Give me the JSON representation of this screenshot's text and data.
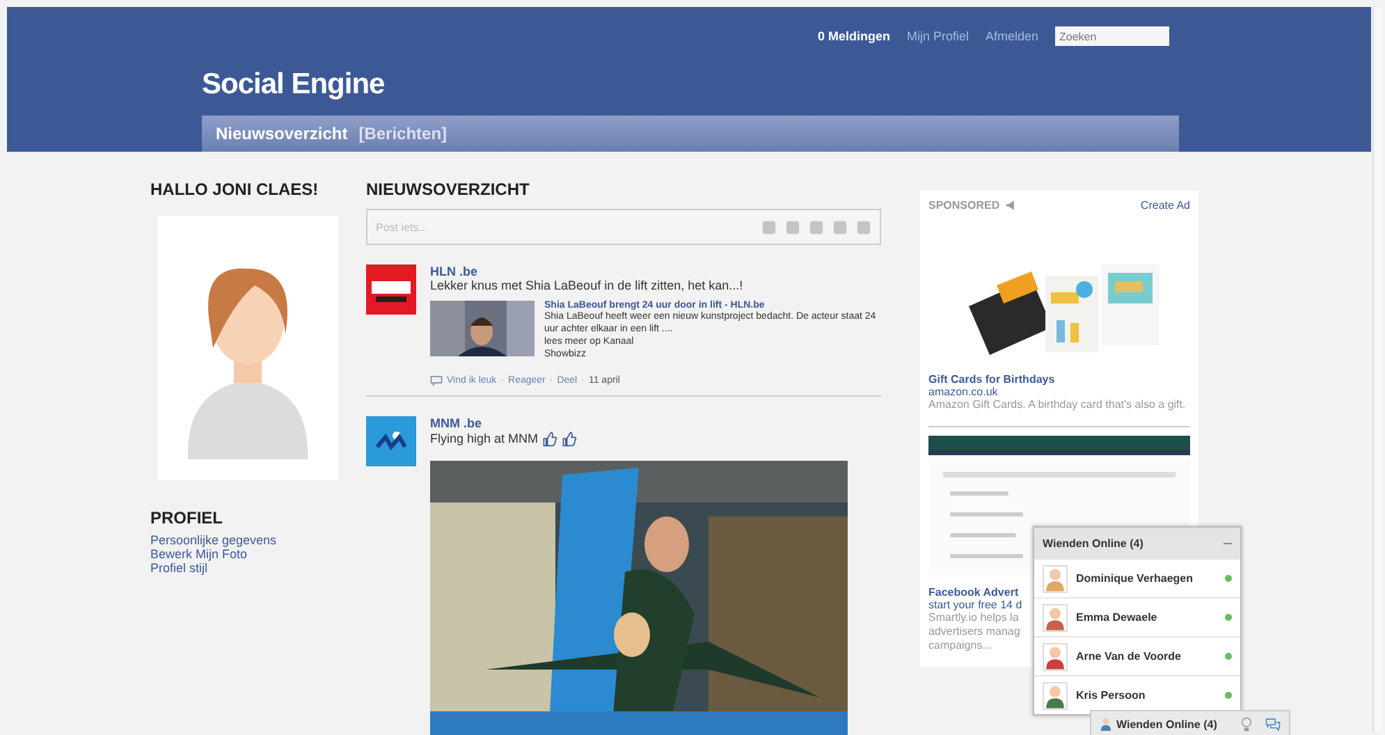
{
  "header": {
    "notifications": "0 Meldingen",
    "links": [
      "Mijn Profiel",
      "Afmelden"
    ],
    "search": {
      "placeholder": "Zoeken"
    },
    "title": "Social Engine"
  },
  "nav": {
    "items": [
      {
        "label": "Nieuwsoverzicht",
        "selected": true
      },
      {
        "label": "[Berichten]",
        "selected": false
      }
    ]
  },
  "left": {
    "greeting": "HALLO JONI CLAES!",
    "profile_heading": "PROFIEL",
    "profile_links": [
      "Persoonlijke gegevens",
      "Bewerk Mijn Foto",
      "Profiel stijl"
    ]
  },
  "feed": {
    "heading": "NIEUWSOVERZICHT",
    "composer": {
      "placeholder": "Post iets..."
    },
    "posts": [
      {
        "kind": "link",
        "author": "HLN .be",
        "text": "Lekker knus met Shia LaBeouf in de lift zitten, het kan...!",
        "link_title": "Shia LaBeouf brengt 24 uur door in lift - HLN.be",
        "link_text": "Shia LaBeouf heeft weer een nieuw kunstproject bedacht. De acteur staat 24 uur achter elkaar in een lift ....",
        "link_more": "lees meer op Kanaal",
        "link_category": "Showbizz",
        "actions": [
          "Vind ik leuk",
          "Reageer",
          "Deel"
        ],
        "separator": "·",
        "date": "11 april"
      },
      {
        "author": "MNM .be",
        "text": "Flying high at MNM"
      }
    ]
  },
  "ads": {
    "label": "SPONSORED",
    "create": "Create Ad",
    "items": [
      {
        "title": "Gift Cards for Birthdays",
        "domain": "amazon.co.uk",
        "text": "Amazon Gift Cards. A birthday card that's also a gift."
      },
      {
        "title": "Facebook Advert",
        "domain": "start your free 14 d",
        "lines": [
          "Smartly.io helps la",
          "advertisers manag",
          "campaigns..."
        ]
      }
    ]
  },
  "chat": {
    "title": "Wienden Online (4)",
    "friends": [
      {
        "name": "Dominique Verhaegen",
        "online": true,
        "color": "#e0a860"
      },
      {
        "name": "Emma Dewaele",
        "online": true,
        "color": "#c8604a"
      },
      {
        "name": "Arne Van de Voorde",
        "online": true,
        "color": "#c84040"
      },
      {
        "name": "Kris Persoon",
        "online": true,
        "color": "#4a7a4a"
      }
    ],
    "bar_label": "Wienden Online (4)"
  }
}
